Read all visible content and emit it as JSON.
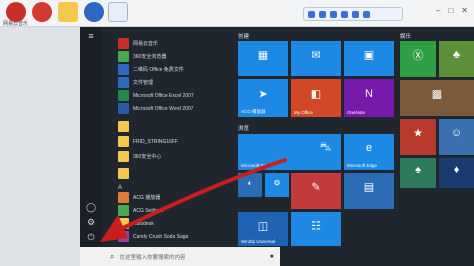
{
  "desktop": {
    "icons": [
      {
        "name": "netease-music-icon",
        "color": "#c8302a",
        "label": "网易云音乐"
      },
      {
        "name": "app-red-icon",
        "color": "#d23a2f",
        "label": ""
      },
      {
        "name": "folder-icon",
        "color": "#f2c94c",
        "label": ""
      },
      {
        "name": "app-blue-icon",
        "color": "#2f66c4",
        "label": ""
      },
      {
        "name": "word-doc-icon",
        "color": "#e8eef8",
        "label": ""
      }
    ]
  },
  "start_menu": {
    "apps": [
      {
        "label": "网易云音乐",
        "color": "#c8302a",
        "kind": "app"
      },
      {
        "label": "360安全浏览器",
        "color": "#4aa851",
        "kind": "app"
      },
      {
        "label": "二维码 Office 免费文件",
        "color": "#2f66c4",
        "kind": "app"
      },
      {
        "label": "文件管理",
        "color": "#2b6cb8",
        "kind": "app"
      },
      {
        "label": "Microsoft Office Excel 2007",
        "color": "#1f8a4c",
        "kind": "app"
      },
      {
        "label": "Microsoft Office Word 2007",
        "color": "#2b5aa8",
        "kind": "app"
      },
      {
        "label": "",
        "color": "#f2c94c",
        "kind": "folder"
      },
      {
        "label": "FRID_STRING16FF",
        "color": "#f2c94c",
        "kind": "folder"
      },
      {
        "label": "360安全中心",
        "color": "#f2c94c",
        "kind": "folder"
      },
      {
        "label": "",
        "color": "#f2c94c",
        "kind": "folder"
      },
      {
        "label": "A",
        "color": "",
        "kind": "header"
      },
      {
        "label": "ACG 播放器",
        "color": "#e07b39",
        "kind": "app"
      },
      {
        "label": "ACG Settings",
        "color": "#4aa851",
        "kind": "app"
      },
      {
        "label": "Autodesk",
        "color": "#f2c94c",
        "kind": "folder"
      },
      {
        "label": "Candy Crush Soda Saga",
        "color": "#8e44ad",
        "kind": "app"
      }
    ],
    "search_placeholder": "在这里输入你要搜索的内容",
    "groups": {
      "left": "创建",
      "middle": "浏览",
      "right": "娱乐"
    },
    "tiles": {
      "acg": "ACG 播放器",
      "office": "My Office",
      "onenote": "OneNote",
      "store": "Microsoft Store",
      "edge": "Microsoft Edge",
      "winzip": "WinZip Universal",
      "sketchbook": ""
    }
  },
  "colors": {
    "accent": "#1e88e5",
    "start_bg": "#1f262d",
    "arrow": "#c81e1e"
  }
}
